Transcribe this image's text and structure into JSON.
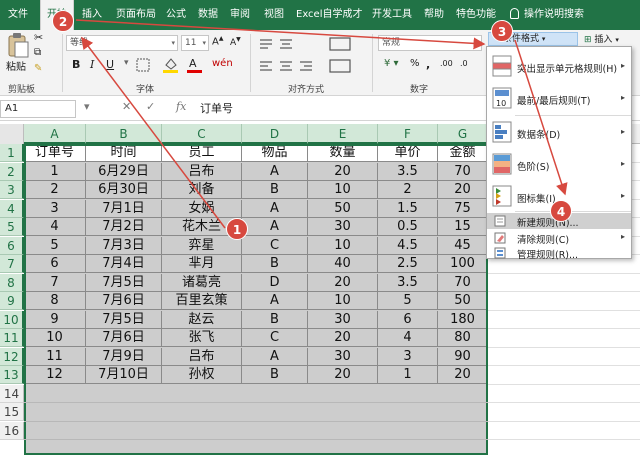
{
  "ribbon_tabs": [
    "文件",
    "开始",
    "插入",
    "页面布局",
    "公式",
    "数据",
    "审阅",
    "视图",
    "Excel自学成才",
    "开发工具",
    "帮助",
    "特色功能"
  ],
  "tell_me": "操作说明搜索",
  "clipboard": {
    "paste": "粘贴",
    "group": "剪贴板"
  },
  "font": {
    "name": "等线",
    "size": "11",
    "group": "字体"
  },
  "alignment": {
    "group": "对齐方式"
  },
  "number": {
    "format": "常规",
    "group": "数字"
  },
  "styles": {
    "conditional_formatting": "条件格式",
    "insert": "插入"
  },
  "formula_bar": {
    "name_box": "A1",
    "content": "订单号"
  },
  "columns": [
    "A",
    "B",
    "C",
    "D",
    "E",
    "F",
    "G"
  ],
  "rows": [
    "1",
    "2",
    "3",
    "4",
    "5",
    "6",
    "7",
    "8",
    "9",
    "10",
    "11",
    "12",
    "13",
    "14",
    "15",
    "16"
  ],
  "table": {
    "headers": [
      "订单号",
      "时间",
      "员工",
      "物品",
      "数量",
      "单价",
      "金额"
    ],
    "rows": [
      [
        "1",
        "6月29日",
        "吕布",
        "A",
        "20",
        "3.5",
        "70"
      ],
      [
        "2",
        "6月30日",
        "刘备",
        "B",
        "10",
        "2",
        "20"
      ],
      [
        "3",
        "7月1日",
        "女娲",
        "A",
        "50",
        "1.5",
        "75"
      ],
      [
        "4",
        "7月2日",
        "花木兰",
        "A",
        "30",
        "0.5",
        "15"
      ],
      [
        "5",
        "7月3日",
        "弈星",
        "C",
        "10",
        "4.5",
        "45"
      ],
      [
        "6",
        "7月4日",
        "芈月",
        "B",
        "40",
        "2.5",
        "100"
      ],
      [
        "7",
        "7月5日",
        "诸葛亮",
        "D",
        "20",
        "3.5",
        "70"
      ],
      [
        "8",
        "7月6日",
        "百里玄策",
        "A",
        "10",
        "5",
        "50"
      ],
      [
        "9",
        "7月5日",
        "赵云",
        "B",
        "30",
        "6",
        "180"
      ],
      [
        "10",
        "7月6日",
        "张飞",
        "C",
        "20",
        "4",
        "80"
      ],
      [
        "11",
        "7月9日",
        "吕布",
        "A",
        "30",
        "3",
        "90"
      ],
      [
        "12",
        "7月10日",
        "孙权",
        "B",
        "20",
        "1",
        "20"
      ]
    ]
  },
  "cf_menu": {
    "items": [
      {
        "label": "突出显示单元格规则(H)",
        "submenu": true
      },
      {
        "label": "最前/最后规则(T)",
        "submenu": true
      },
      {
        "label": "数据条(D)",
        "submenu": true
      },
      {
        "label": "色阶(S)",
        "submenu": true
      },
      {
        "label": "图标集(I)",
        "submenu": true
      },
      {
        "label": "新建规则(N)...",
        "submenu": false
      },
      {
        "label": "清除规则(C)",
        "submenu": true
      },
      {
        "label": "管理规则(R)...",
        "submenu": false
      }
    ],
    "highlighted_index": 5
  },
  "annotations": {
    "badges": [
      "1",
      "2",
      "3",
      "4"
    ],
    "color": "#d7493f"
  },
  "colors": {
    "excel_green": "#217346",
    "selection_fill": "#cdcdcd",
    "menu_highlight": "#d0d0d0"
  }
}
